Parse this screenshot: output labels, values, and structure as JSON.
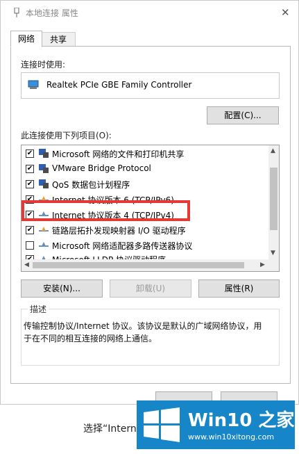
{
  "window": {
    "title": "本地连接 属性",
    "close_glyph": "✕"
  },
  "tabs": [
    {
      "label": "网络",
      "active": true
    },
    {
      "label": "共享",
      "active": false
    }
  ],
  "connect_using": {
    "label": "连接时使用:",
    "adapter": "Realtek PCIe GBE Family Controller",
    "configure_button": "配置(C)..."
  },
  "items_section": {
    "label": "此连接使用下列项目(O):",
    "items": [
      {
        "label": "Microsoft 网络的文件和打印机共享",
        "checked": true,
        "icon": "network-client-icon"
      },
      {
        "label": "VMware Bridge Protocol",
        "checked": true,
        "icon": "network-client-icon"
      },
      {
        "label": "QoS 数据包计划程序",
        "checked": true,
        "icon": "network-client-icon"
      },
      {
        "label": "Internet 协议版本 6 (TCP/IPv6)",
        "checked": true,
        "icon": "protocol-icon"
      },
      {
        "label": "Internet 协议版本 4 (TCP/IPv4)",
        "checked": true,
        "icon": "protocol-icon"
      },
      {
        "label": "链路层拓扑发现映射器 I/O 驱动程序",
        "checked": true,
        "icon": "protocol-icon"
      },
      {
        "label": "Microsoft 网络适配器多路传送器协议",
        "checked": false,
        "icon": "protocol-icon"
      },
      {
        "label": "Microsoft LLDP 协议驱动程序",
        "checked": true,
        "icon": "protocol-icon"
      }
    ],
    "highlighted_item": "Internet 协议版本 4 (TCP/IPv4)"
  },
  "buttons": {
    "install": "安装(N)...",
    "uninstall": "卸载(U)",
    "properties": "属性(R)"
  },
  "description": {
    "title": "描述",
    "line1": "传输控制协议/Internet 协议。该协议是默认的广域网络协议，用",
    "line2": "于在不同的相互连接的网络上通信。"
  },
  "caption": "选择“Interne",
  "watermark": {
    "brand_main": "Win10 之家",
    "url": "www.win10xitong.com"
  },
  "colors": {
    "highlight": "#e53935",
    "watermark_bg": "#1686c9"
  }
}
